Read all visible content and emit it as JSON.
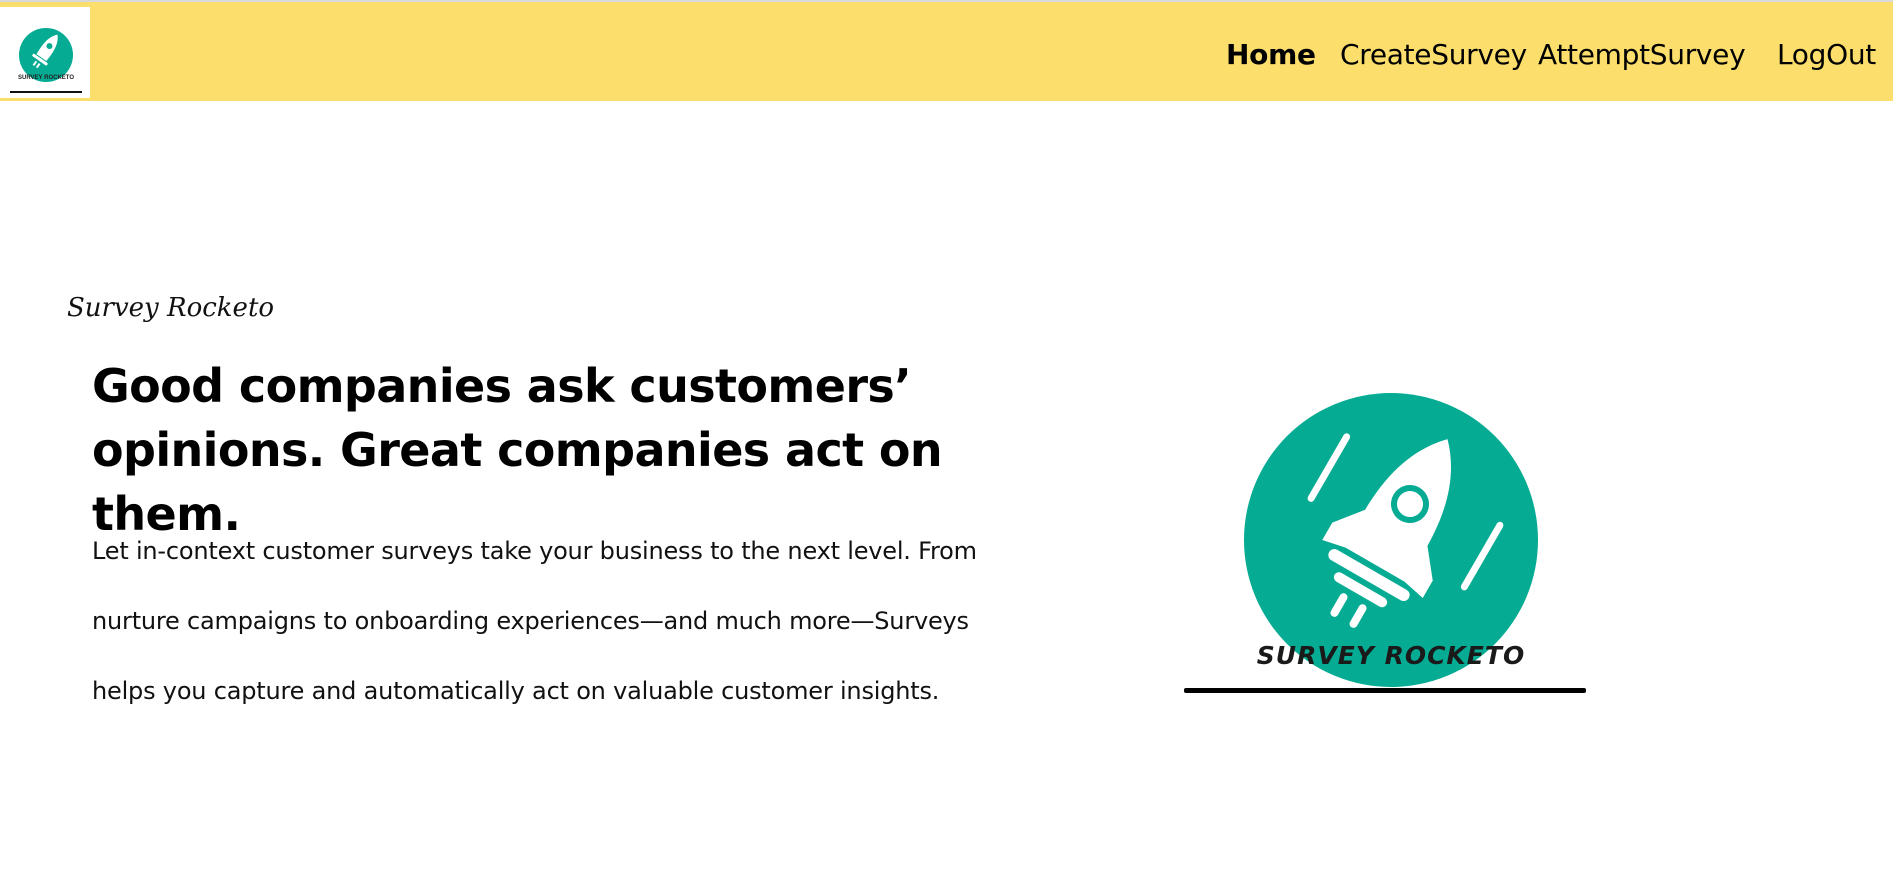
{
  "header": {
    "logo_text": "SURVEY ROCKETO",
    "nav": {
      "home": "Home",
      "create": "CreateSurvey",
      "attempt": "AttemptSurvey",
      "logout": "LogOut"
    },
    "active": "home"
  },
  "hero": {
    "eyebrow": "Survey Rocketo",
    "headline": "Good companies ask customers’ opinions. Great companies act on them.",
    "body": "Let in-context customer surveys take your business to the next level. From nurture campaigns to onboarding experiences—and much more—Surveys helps you capture and automatically act on valuable customer insights.",
    "logo_text": "SURVEY ROCKETO"
  },
  "colors": {
    "header_bg": "#fbde6b",
    "brand_teal": "#05ab92"
  }
}
